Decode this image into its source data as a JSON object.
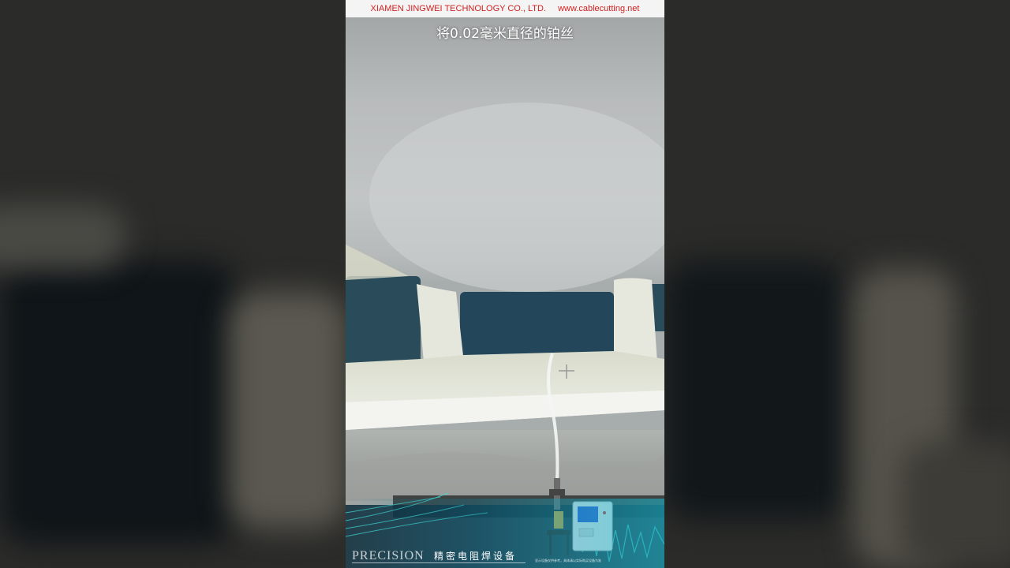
{
  "banner": {
    "company": "XIAMEN JINGWEI TECHNOLOGY CO., LTD.",
    "website": "www.cablecutting.net"
  },
  "subtitle": "将0.02毫米直径的铂丝",
  "brand": {
    "latin": "PRECISION",
    "chinese": "精密电阻焊设备",
    "note": "显示设备仅供参考，具体请以实际购买设备为准"
  },
  "colors": {
    "banner_text": "#d21f1f",
    "subtitle_text": "#ffffff",
    "teal_accent": "#1eb4c8"
  }
}
